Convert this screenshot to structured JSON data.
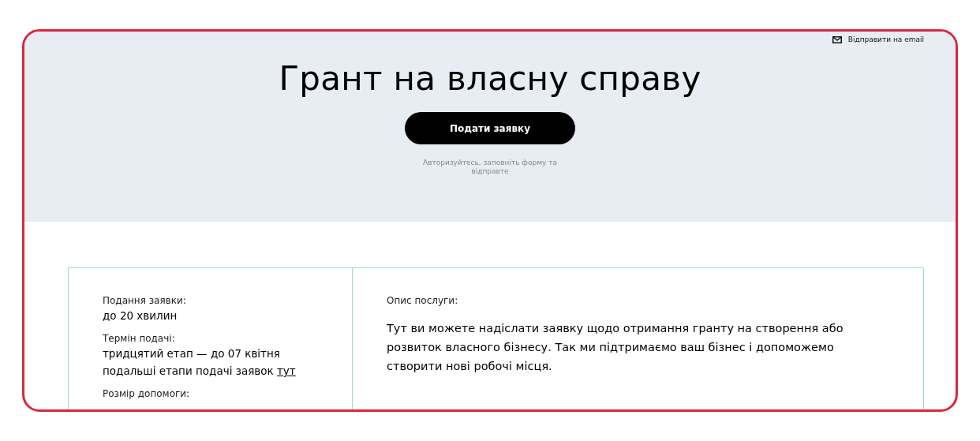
{
  "email_link": "Відправити на email",
  "title": "Грант на власну справу",
  "apply_button": "Подати заявку",
  "hint": "Авторизуйтесь, заповніть форму та відправте",
  "details": [
    {
      "label": "Подання заявки:",
      "lines": [
        {
          "text": "до 20 хвилин"
        }
      ]
    },
    {
      "label": "Термін подачі:",
      "lines": [
        {
          "text": "тридцятий етап — до 07 квітня"
        },
        {
          "text": "подальші етапи подачі заявок",
          "link": "тут"
        }
      ]
    },
    {
      "label": "Розмір допомоги:"
    }
  ],
  "description": {
    "label": "Опис послуги:",
    "text": "Тут ви можете надіслати заявку щодо отримання гранту на створення або розвиток власного бізнесу. Так ми підтримаємо ваш бізнес і допоможемо створити нові робочі місця."
  }
}
